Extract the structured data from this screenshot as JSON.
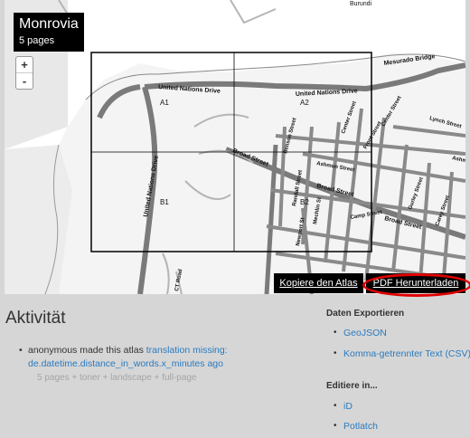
{
  "map": {
    "title": "Monrovia",
    "pages": "5 pages",
    "zoom_in": "+",
    "zoom_out": "-",
    "page_labels": [
      "A1",
      "A2",
      "B1",
      "B2"
    ],
    "streets": {
      "burundi": "Burundi",
      "mesurado_bridge": "Mesurado Bridge",
      "un_drive_1": "United Nations Drive",
      "un_drive_2": "United Nations Drive",
      "un_drive_vertical": "United Nations Drive",
      "broad_street_1": "Broad Street",
      "broad_street_2": "Broad Street",
      "broad_street_3": "Broad Street",
      "ashmun_street": "Ashmun Street",
      "randall_street": "Randall Street",
      "mechlin_st": "Mechlin St",
      "camp_street": "Camp Street",
      "newport_st": "Newport St",
      "cth_road": "CT Road",
      "benson_street": "Benson Street",
      "center_street": "Center Street",
      "front_street": "Front Street",
      "gurley_street": "Gurley Street",
      "carey_street": "Carey Street",
      "center_street_2": "Center Street",
      "lynch_street": "Lynch Street",
      "ashmun_st_2": "Ashmun St"
    }
  },
  "buttons": {
    "copy_atlas": "Kopiere den Atlas",
    "download_pdf": "PDF Herunterladen"
  },
  "activity": {
    "title": "Aktivität",
    "item_text": "anonymous made this atlas",
    "item_link": "translation missing: de.datetime.distance_in_words.x_minutes ago",
    "meta": "5 pages + toner + landscape + full-page"
  },
  "export": {
    "heading": "Daten Exportieren",
    "links": [
      "GeoJSON",
      "Komma-getrennter Text (CSV)"
    ]
  },
  "edit": {
    "heading": "Editiere in...",
    "links": [
      "iD",
      "Potlatch"
    ]
  },
  "colors": {
    "accent_link": "#2a7bbf",
    "highlight_ring": "#e00000"
  }
}
